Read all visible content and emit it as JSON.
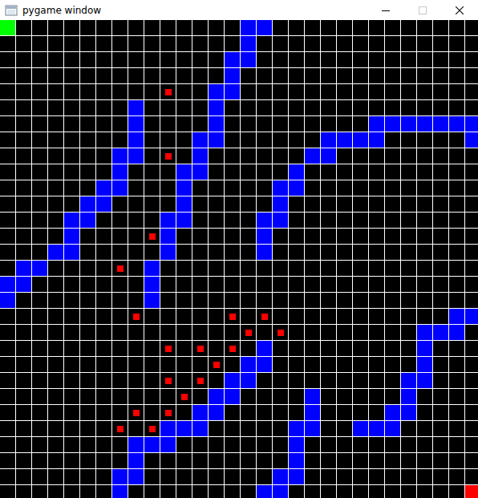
{
  "window": {
    "title": "pygame window"
  },
  "grid": {
    "columns": 30,
    "rows": 30
  },
  "start": {
    "col": 0,
    "row": 0
  },
  "goal": {
    "col": 29,
    "row": 29
  },
  "walls": [
    [
      15,
      0
    ],
    [
      16,
      0
    ],
    [
      15,
      1
    ],
    [
      14,
      2
    ],
    [
      15,
      2
    ],
    [
      14,
      3
    ],
    [
      13,
      4
    ],
    [
      14,
      4
    ],
    [
      8,
      5
    ],
    [
      13,
      5
    ],
    [
      8,
      6
    ],
    [
      13,
      6
    ],
    [
      23,
      6
    ],
    [
      24,
      6
    ],
    [
      25,
      6
    ],
    [
      26,
      6
    ],
    [
      27,
      6
    ],
    [
      28,
      6
    ],
    [
      29,
      6
    ],
    [
      8,
      7
    ],
    [
      12,
      7
    ],
    [
      13,
      7
    ],
    [
      20,
      7
    ],
    [
      21,
      7
    ],
    [
      22,
      7
    ],
    [
      23,
      7
    ],
    [
      29,
      7
    ],
    [
      7,
      8
    ],
    [
      8,
      8
    ],
    [
      12,
      8
    ],
    [
      19,
      8
    ],
    [
      20,
      8
    ],
    [
      7,
      9
    ],
    [
      11,
      9
    ],
    [
      12,
      9
    ],
    [
      18,
      9
    ],
    [
      6,
      10
    ],
    [
      7,
      10
    ],
    [
      11,
      10
    ],
    [
      17,
      10
    ],
    [
      18,
      10
    ],
    [
      5,
      11
    ],
    [
      6,
      11
    ],
    [
      11,
      11
    ],
    [
      17,
      11
    ],
    [
      4,
      12
    ],
    [
      5,
      12
    ],
    [
      10,
      12
    ],
    [
      11,
      12
    ],
    [
      16,
      12
    ],
    [
      17,
      12
    ],
    [
      4,
      13
    ],
    [
      10,
      13
    ],
    [
      16,
      13
    ],
    [
      3,
      14
    ],
    [
      4,
      14
    ],
    [
      10,
      14
    ],
    [
      16,
      14
    ],
    [
      1,
      15
    ],
    [
      2,
      15
    ],
    [
      9,
      15
    ],
    [
      0,
      16
    ],
    [
      1,
      16
    ],
    [
      9,
      16
    ],
    [
      0,
      17
    ],
    [
      9,
      17
    ],
    [
      28,
      18
    ],
    [
      29,
      18
    ],
    [
      26,
      19
    ],
    [
      27,
      19
    ],
    [
      28,
      19
    ],
    [
      16,
      20
    ],
    [
      26,
      20
    ],
    [
      15,
      21
    ],
    [
      16,
      21
    ],
    [
      26,
      21
    ],
    [
      14,
      22
    ],
    [
      15,
      22
    ],
    [
      25,
      22
    ],
    [
      26,
      22
    ],
    [
      13,
      23
    ],
    [
      14,
      23
    ],
    [
      19,
      23
    ],
    [
      25,
      23
    ],
    [
      12,
      24
    ],
    [
      13,
      24
    ],
    [
      19,
      24
    ],
    [
      24,
      24
    ],
    [
      25,
      24
    ],
    [
      10,
      25
    ],
    [
      11,
      25
    ],
    [
      12,
      25
    ],
    [
      18,
      25
    ],
    [
      19,
      25
    ],
    [
      22,
      25
    ],
    [
      23,
      25
    ],
    [
      24,
      25
    ],
    [
      8,
      26
    ],
    [
      9,
      26
    ],
    [
      10,
      26
    ],
    [
      18,
      26
    ],
    [
      8,
      27
    ],
    [
      18,
      27
    ],
    [
      7,
      28
    ],
    [
      8,
      28
    ],
    [
      17,
      28
    ],
    [
      18,
      28
    ],
    [
      7,
      29
    ],
    [
      16,
      29
    ],
    [
      17,
      29
    ]
  ],
  "dots": [
    [
      10,
      4
    ],
    [
      10,
      8
    ],
    [
      9,
      13
    ],
    [
      7,
      15
    ],
    [
      8,
      18
    ],
    [
      14,
      18
    ],
    [
      16,
      18
    ],
    [
      15,
      19
    ],
    [
      17,
      19
    ],
    [
      10,
      20
    ],
    [
      12,
      20
    ],
    [
      14,
      20
    ],
    [
      13,
      21
    ],
    [
      10,
      22
    ],
    [
      12,
      22
    ],
    [
      11,
      23
    ],
    [
      8,
      24
    ],
    [
      10,
      24
    ],
    [
      7,
      25
    ],
    [
      9,
      25
    ]
  ]
}
